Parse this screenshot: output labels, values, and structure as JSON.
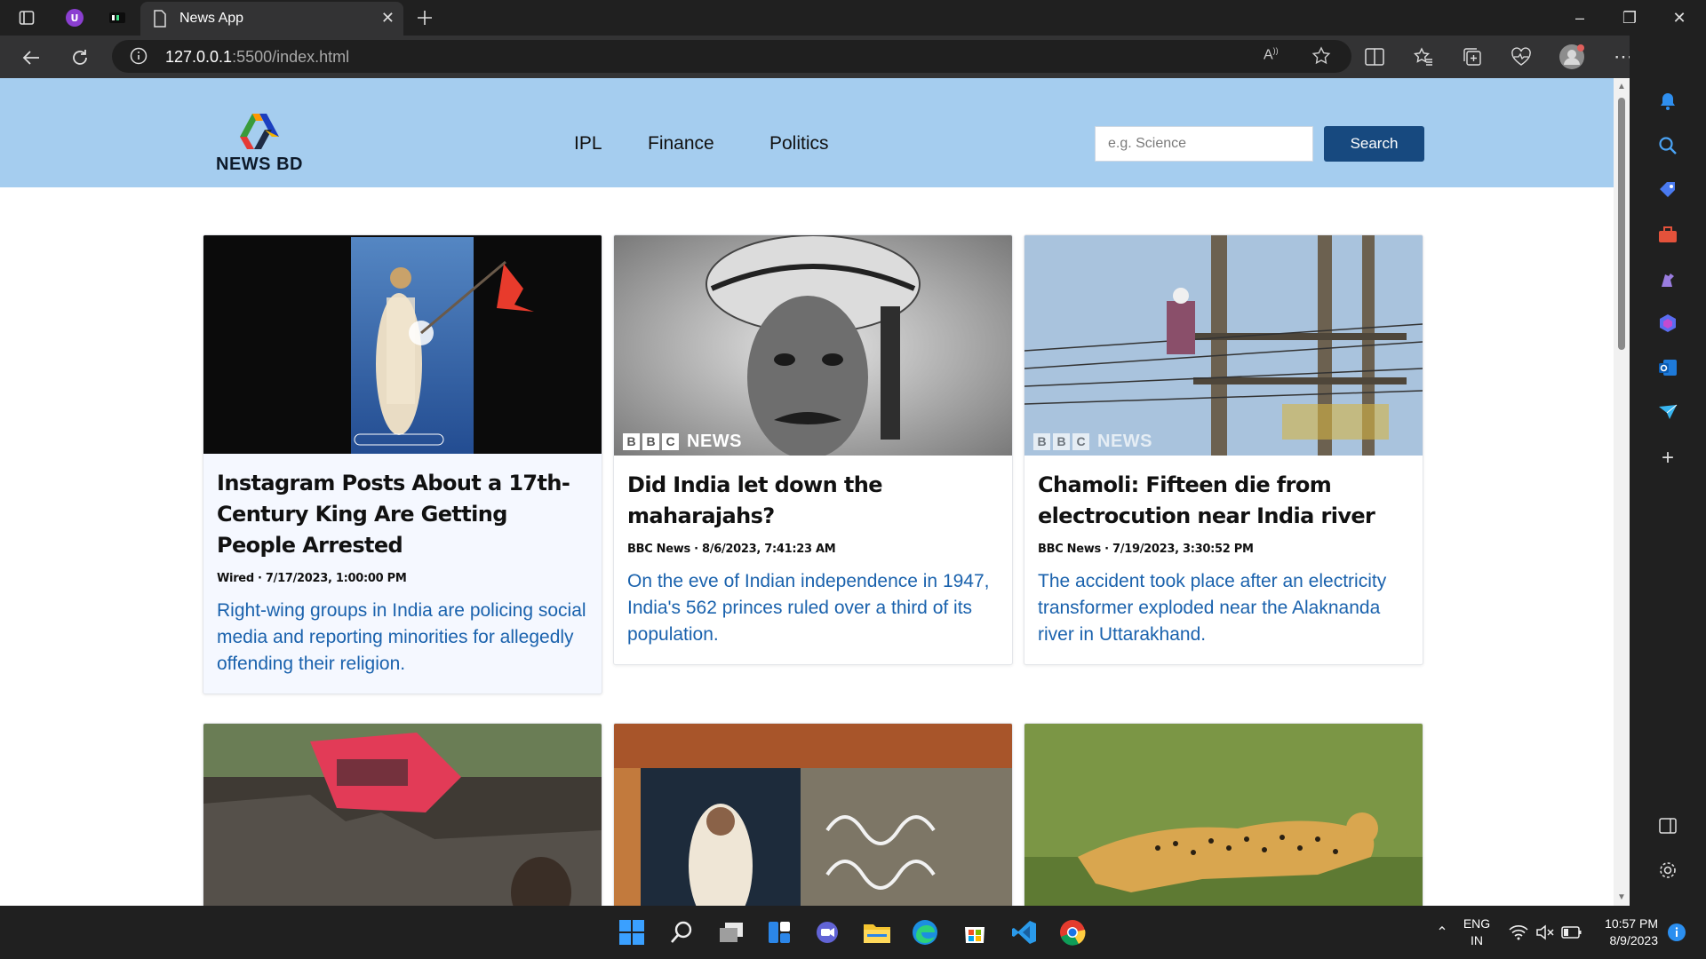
{
  "browser": {
    "tab_title": "News App",
    "url_host": "127.0.0.1",
    "url_path": ":5500/index.html"
  },
  "site": {
    "logo_text": "NEWS BD",
    "nav": [
      "IPL",
      "Finance",
      "Politics"
    ],
    "search_placeholder": "e.g. Science",
    "search_button": "Search"
  },
  "articles": [
    {
      "title": "Instagram Posts About a 17th-Century King Are Getting People Arrested",
      "meta": "Wired · 7/17/2023, 1:00:00 PM",
      "description": "Right-wing groups in India are policing social media and reporting minorities for allegedly offending their religion.",
      "bbc": ""
    },
    {
      "title": "Did India let down the maharajahs?",
      "meta": "BBC News · 8/6/2023, 7:41:23 AM",
      "description": "On the eve of Indian independence in 1947, India's 562 princes ruled over a third of its population.",
      "bbc": "NEWS"
    },
    {
      "title": "Chamoli: Fifteen die from electrocution near India river",
      "meta": "BBC News · 7/19/2023, 3:30:52 PM",
      "description": "The accident took place after an electricity transformer exploded near the Alaknanda river in Uttarakhand.",
      "bbc": "NEWS"
    }
  ],
  "bbc_letters": [
    "B",
    "B",
    "C"
  ],
  "taskbar": {
    "lang_line1": "ENG",
    "lang_line2": "IN",
    "time": "10:57 PM",
    "date": "8/9/2023"
  },
  "colors": {
    "nav_bg": "#a5cdef",
    "search_btn": "#17497f",
    "desc_text": "#1a62ad"
  }
}
